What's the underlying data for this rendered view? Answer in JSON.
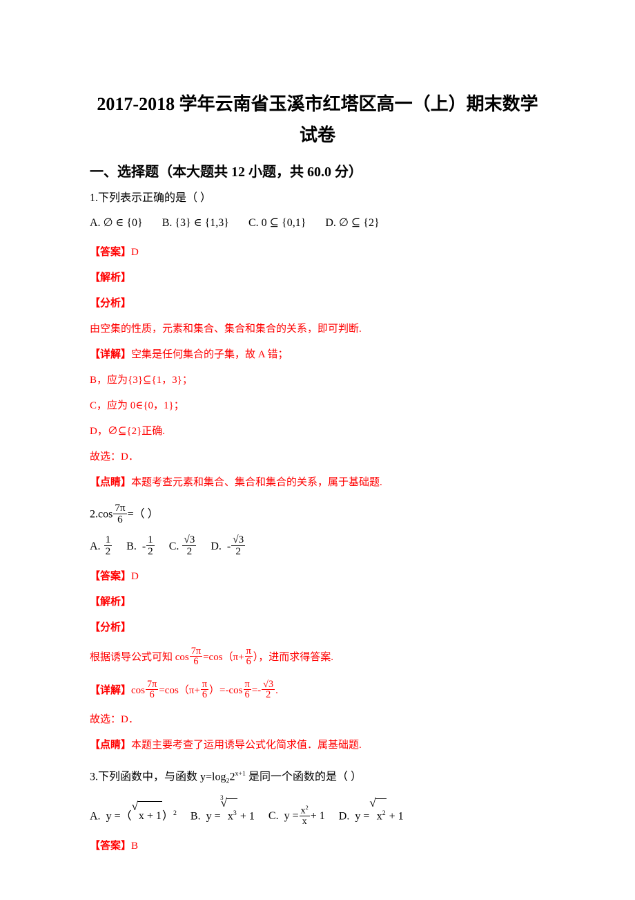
{
  "document": {
    "title": "2017-2018 学年云南省玉溪市红塔区高一（上）期末数学试卷",
    "section_heading": "一、选择题（本大题共 12 小题，共 60.0 分）"
  },
  "labels": {
    "answer_tag": "【答案】",
    "analysis_tag": "【解析】",
    "approach_tag": "【分析】",
    "detail_tag": "【详解】",
    "insight_tag": "【点睛】",
    "choose_prefix": "故选：",
    "opt_a": "A.",
    "opt_b": "B.",
    "opt_c": "C.",
    "opt_d": "D.",
    "paren_open": "（",
    "paren_close": "）",
    "blank_paren": "（      ）"
  },
  "questions": [
    {
      "number": "1.",
      "stem": "下列表示正确的是（      ）",
      "options": [
        {
          "letter": "A.",
          "text": "∅ ∈ {0}"
        },
        {
          "letter": "B.",
          "text": "{3} ∈ {1,3}"
        },
        {
          "letter": "C.",
          "text": "0 ⊆ {0,1}"
        },
        {
          "letter": "D.",
          "text": "∅ ⊆ {2}"
        }
      ],
      "answer": "D",
      "approach": "由空集的性质，元素和集合、集合和集合的关系，即可判断.",
      "detail_lines": [
        "空集是任何集合的子集，故 A 错；",
        "B，应为{3}⊆{1，3}；",
        "C，应为 0∈{0，1}；",
        "D，∅⊆{2}正确."
      ],
      "choose": "故选：D．",
      "insight": "本题考查元素和集合、集合和集合的关系，属于基础题."
    },
    {
      "number": "2.",
      "stem_prefix": "cos",
      "stem_frac_num": "7π",
      "stem_frac_den": "6",
      "stem_suffix": "=（      ）",
      "options": [
        {
          "letter": "A.",
          "sign": "",
          "num": "1",
          "den": "2"
        },
        {
          "letter": "B.",
          "sign": "-",
          "num": "1",
          "den": "2"
        },
        {
          "letter": "C.",
          "sign": "",
          "num": "√3",
          "den": "2"
        },
        {
          "letter": "D.",
          "sign": "-",
          "num": "√3",
          "den": "2"
        }
      ],
      "answer": "D",
      "approach_pre": "根据诱导公式可知 cos",
      "approach_frac_num": "7π",
      "approach_frac_den": "6",
      "approach_mid": "=cos（π+",
      "approach_frac2_num": "π",
      "approach_frac2_den": "6",
      "approach_post": "），进而求得答案.",
      "detail_pre": "cos",
      "detail_f1_num": "7π",
      "detail_f1_den": "6",
      "detail_m1": "=cos（π+",
      "detail_f2_num": "π",
      "detail_f2_den": "6",
      "detail_m2": "）=-cos",
      "detail_f3_num": "π",
      "detail_f3_den": "6",
      "detail_m3": "=-",
      "detail_f4_num": "√3",
      "detail_f4_den": "2",
      "detail_post": ".",
      "choose": "故选：D．",
      "insight": "本题主要考查了运用诱导公式化简求值．属基础题."
    },
    {
      "number": "3.",
      "stem_pre": "下列函数中，与函数 y=log",
      "stem_sub": "2",
      "stem_base": "2",
      "stem_sup": "x+1",
      "stem_post": " 是同一个函数的是（      ）",
      "options": [
        {
          "letter": "A.",
          "form": "y =（√(x+1)）²"
        },
        {
          "letter": "B.",
          "form": "y = ³√(x³) + 1"
        },
        {
          "letter": "C.",
          "form": "y = x²/x + 1"
        },
        {
          "letter": "D.",
          "form": "y = √(x²) + 1"
        }
      ],
      "answer": "B"
    }
  ],
  "colors": {
    "annotation_red": "#ff0000",
    "body_black": "#000000",
    "page_background": "#ffffff"
  }
}
